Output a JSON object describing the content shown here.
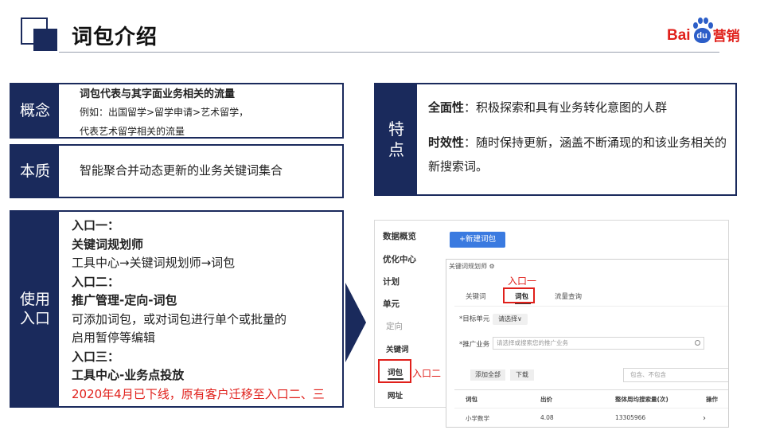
{
  "header": {
    "title": "词包介绍"
  },
  "logo": {
    "part1": "Bai",
    "paw": "du",
    "part2": "营销"
  },
  "concept": {
    "label": "概念",
    "line1": "词包代表与其字面业务相关的流量",
    "line2": "例如：出国留学>留学申请>艺术留学，",
    "line3": "代表艺术留学相关的流量"
  },
  "essence": {
    "label": "本质",
    "text": "智能聚合并动态更新的业务关键词集合"
  },
  "features": {
    "label_line1": "特",
    "label_line2": "点",
    "item1_title": "全面性",
    "item1_text": "：积极探索和具有业务转化意图的人群",
    "item2_title": "时效性",
    "item2_text": "：随时保持更新，涵盖不断涌现的和该业务相关的新搜索词。"
  },
  "entry": {
    "label_line1": "使用",
    "label_line2": "入口",
    "e1_head": "入口一：",
    "e1_name": "关键词规划师",
    "e1_path": "工具中心→关键词规划师→词包",
    "e2_head": "入口二：",
    "e2_name": "推广管理-定向-词包",
    "e2_desc1": "可添加词包，或对词包进行单个或批量的",
    "e2_desc2": "启用暂停等编辑",
    "e3_head": "入口三：",
    "e3_name": "工具中心-业务点投放",
    "e3_note": "2020年4月已下线，原有客户迁移至入口二、三"
  },
  "screenshot": {
    "nav": [
      "数据概览",
      "优化中心",
      "计划",
      "单元",
      "定向",
      "关键词",
      "词包",
      "网址"
    ],
    "new_button": "+新建词包",
    "planner_title": "关键词规划师",
    "tabs": [
      "关键词",
      "词包",
      "流量查询"
    ],
    "target_unit_label": "*目标单元",
    "target_unit_select": "请选择∨",
    "biz_label": "*推广业务",
    "biz_placeholder": "请选择或搜索您的推广业务",
    "add_all": "添加全部",
    "download": "下载",
    "filter_placeholder": "包含、不包含",
    "columns": [
      "词包",
      "出价",
      "整体周均搜索量(次)",
      "操作"
    ],
    "row": [
      "小学数学",
      "4.08",
      "13305966",
      "›"
    ]
  },
  "callouts": {
    "entry1": "入口一",
    "entry2": "入口二"
  },
  "colors": {
    "navy": "#1a2a5c",
    "red": "#e0201b",
    "blue_button": "#3a7ae0"
  }
}
